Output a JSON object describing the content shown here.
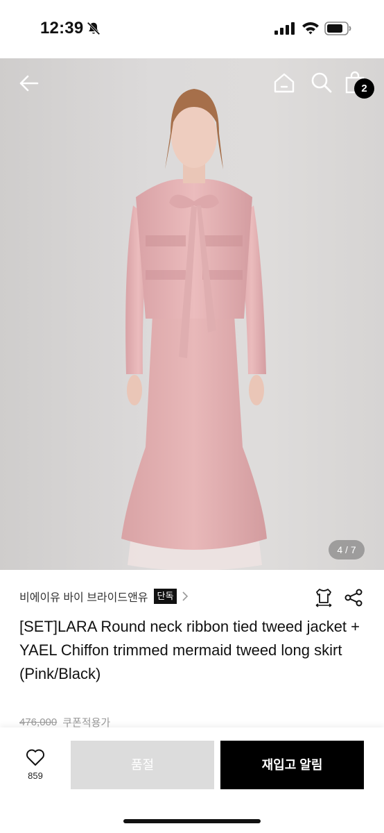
{
  "status_bar": {
    "time": "12:39",
    "icons": [
      "bell-slash-icon",
      "cellular-signal-icon",
      "wifi-icon",
      "battery-icon"
    ]
  },
  "header": {
    "icons": [
      "back-arrow-icon",
      "home-icon",
      "search-icon",
      "shopping-bag-icon"
    ],
    "cart_count": "2"
  },
  "gallery": {
    "page_indicator": "4 / 7"
  },
  "product": {
    "brand": "비에이유 바이 브라이드앤유",
    "exclusive_badge": "단독",
    "title": "[SET]LARA Round neck ribbon tied tweed jacket + YAEL Chiffon trimmed mermaid tweed long skirt (Pink/Black)",
    "original_price": "476,000",
    "coupon_label": "쿠폰적용가"
  },
  "bottom_bar": {
    "like_count": "859",
    "soldout_label": "품절",
    "restock_label": "재입고 알림"
  },
  "colors": {
    "accent": "#000000",
    "soldout_bg": "#dcdcdc",
    "badge_bg": "#111111"
  }
}
